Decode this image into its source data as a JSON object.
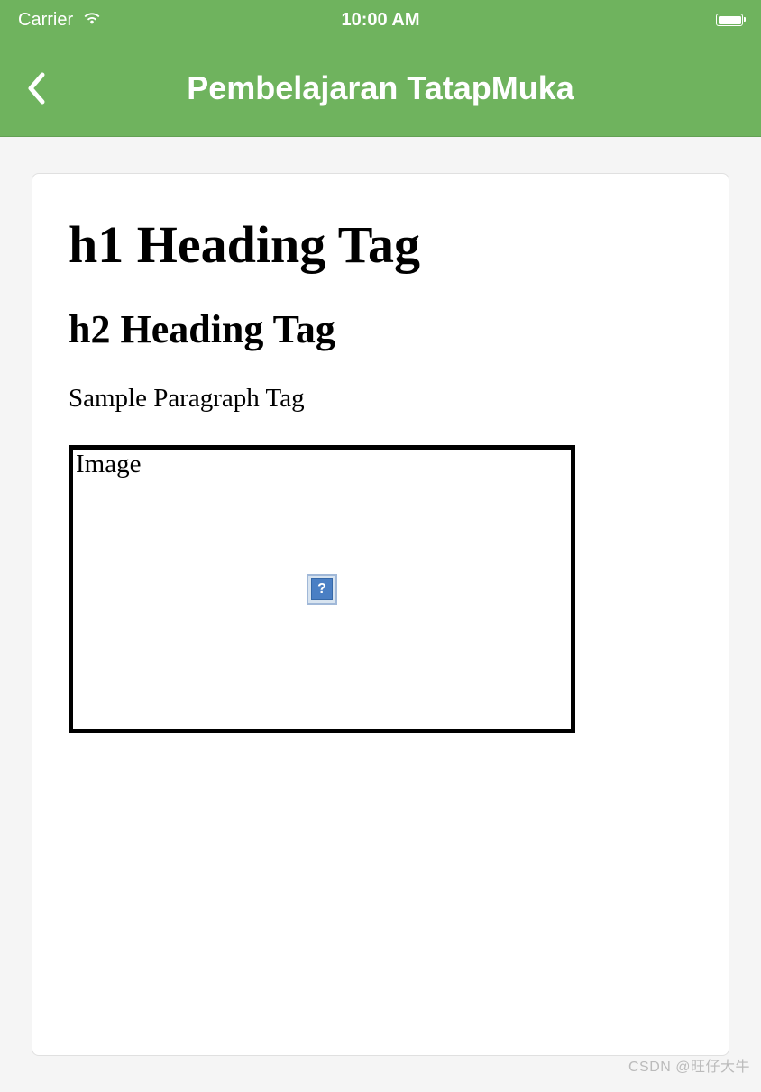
{
  "statusBar": {
    "carrier": "Carrier",
    "time": "10:00 AM"
  },
  "navBar": {
    "title": "Pembelajaran TatapMuka"
  },
  "content": {
    "h1": "h1 Heading Tag",
    "h2": "h2 Heading Tag",
    "paragraph": "Sample Paragraph Tag",
    "imageAlt": "Image",
    "brokenIcon": "?"
  },
  "watermark": "CSDN @旺仔大牛"
}
